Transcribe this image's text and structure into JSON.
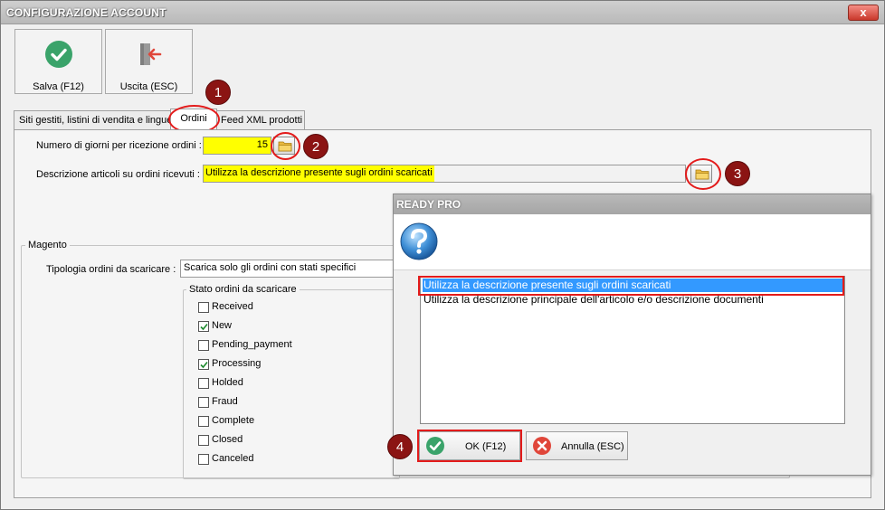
{
  "window": {
    "title": "CONFIGURAZIONE ACCOUNT",
    "close": "x"
  },
  "toolbar": {
    "save_label": "Salva (F12)",
    "exit_label": "Uscita (ESC)"
  },
  "tabs": [
    {
      "label": "Siti gestiti, listini di vendita e lingue"
    },
    {
      "label": "Ordini"
    },
    {
      "label": "Feed XML prodotti"
    }
  ],
  "orders": {
    "days_label": "Numero di giorni per ricezione ordini :",
    "days_value": "15",
    "desc_label": "Descrizione articoli su ordini ricevuti :",
    "desc_value": "Utilizza la descrizione presente sugli ordini scaricati"
  },
  "magento": {
    "group_title": "Magento",
    "type_label": "Tipologia ordini da scaricare :",
    "type_value": "Scarica solo gli ordini con stati specifici",
    "status_group_title": "Stato ordini da scaricare",
    "statuses": [
      {
        "label": "Received",
        "checked": false
      },
      {
        "label": "New",
        "checked": true
      },
      {
        "label": "Pending_payment",
        "checked": false
      },
      {
        "label": "Processing",
        "checked": true
      },
      {
        "label": "Holded",
        "checked": false
      },
      {
        "label": "Fraud",
        "checked": false
      },
      {
        "label": "Complete",
        "checked": false
      },
      {
        "label": "Closed",
        "checked": false
      },
      {
        "label": "Canceled",
        "checked": false
      }
    ]
  },
  "dialog": {
    "title": "READY PRO",
    "options": [
      {
        "label": "Utilizza la descrizione presente sugli ordini scaricati",
        "selected": true
      },
      {
        "label": "Utilizza la descrizione principale dell'articolo e/o descrizione documenti",
        "selected": false
      }
    ],
    "ok_label": "OK (F12)",
    "cancel_label": "Annulla (ESC)"
  },
  "annotations": [
    "1",
    "2",
    "3",
    "4"
  ],
  "colors": {
    "highlight": "#ffff00",
    "annotation_red": "#e31b1b",
    "badge": "#8b1413",
    "selection": "#3399ff"
  }
}
